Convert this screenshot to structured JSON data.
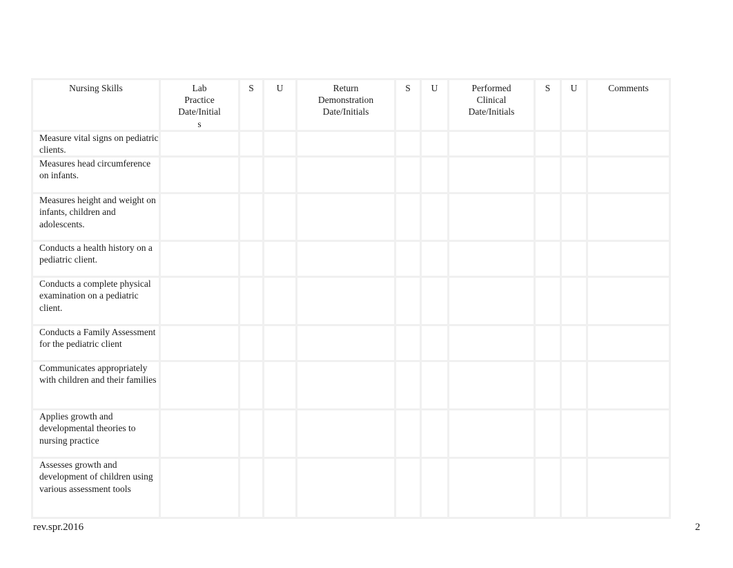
{
  "table": {
    "headers": [
      {
        "label": "Nursing Skills"
      },
      {
        "label": "Lab\nPractice\nDate/Initial\ns"
      },
      {
        "label": "S"
      },
      {
        "label": "U"
      },
      {
        "label": "Return\nDemonstration\nDate/Initials"
      },
      {
        "label": "S"
      },
      {
        "label": "U"
      },
      {
        "label": "Performed\nClinical\nDate/Initials"
      },
      {
        "label": "S"
      },
      {
        "label": "U"
      },
      {
        "label": "Comments"
      }
    ],
    "rows": [
      {
        "skill": "Measure vital signs on pediatric clients."
      },
      {
        "skill": "Measures head circumference on infants."
      },
      {
        "skill": "Measures height and weight on infants, children and adolescents."
      },
      {
        "skill": "Conducts a health history on a pediatric client."
      },
      {
        "skill": "Conducts a complete physical examination on a pediatric client."
      },
      {
        "skill": "Conducts a Family Assessment for the pediatric client"
      },
      {
        "skill": "Communicates appropriately with children and their families"
      },
      {
        "skill": "Applies growth and developmental theories to nursing practice"
      },
      {
        "skill": "Assesses growth and development of children using various assessment tools"
      }
    ]
  },
  "footer": {
    "revision": "rev.spr.2016",
    "page_number": "2"
  }
}
